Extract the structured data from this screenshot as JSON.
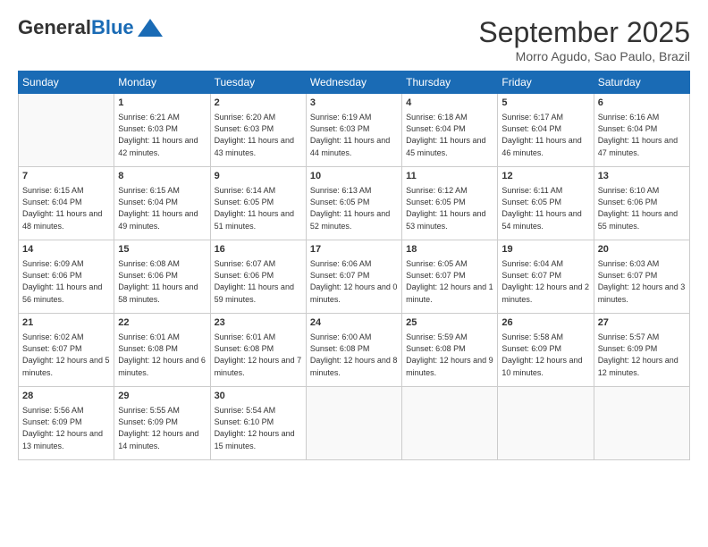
{
  "header": {
    "logo_general": "General",
    "logo_blue": "Blue",
    "month_title": "September 2025",
    "location": "Morro Agudo, Sao Paulo, Brazil"
  },
  "days_of_week": [
    "Sunday",
    "Monday",
    "Tuesday",
    "Wednesday",
    "Thursday",
    "Friday",
    "Saturday"
  ],
  "weeks": [
    [
      {
        "day": "",
        "empty": true
      },
      {
        "day": "1",
        "sunrise": "6:21 AM",
        "sunset": "6:03 PM",
        "daylight": "11 hours and 42 minutes."
      },
      {
        "day": "2",
        "sunrise": "6:20 AM",
        "sunset": "6:03 PM",
        "daylight": "11 hours and 43 minutes."
      },
      {
        "day": "3",
        "sunrise": "6:19 AM",
        "sunset": "6:03 PM",
        "daylight": "11 hours and 44 minutes."
      },
      {
        "day": "4",
        "sunrise": "6:18 AM",
        "sunset": "6:04 PM",
        "daylight": "11 hours and 45 minutes."
      },
      {
        "day": "5",
        "sunrise": "6:17 AM",
        "sunset": "6:04 PM",
        "daylight": "11 hours and 46 minutes."
      },
      {
        "day": "6",
        "sunrise": "6:16 AM",
        "sunset": "6:04 PM",
        "daylight": "11 hours and 47 minutes."
      }
    ],
    [
      {
        "day": "7",
        "sunrise": "6:15 AM",
        "sunset": "6:04 PM",
        "daylight": "11 hours and 48 minutes."
      },
      {
        "day": "8",
        "sunrise": "6:15 AM",
        "sunset": "6:04 PM",
        "daylight": "11 hours and 49 minutes."
      },
      {
        "day": "9",
        "sunrise": "6:14 AM",
        "sunset": "6:05 PM",
        "daylight": "11 hours and 51 minutes."
      },
      {
        "day": "10",
        "sunrise": "6:13 AM",
        "sunset": "6:05 PM",
        "daylight": "11 hours and 52 minutes."
      },
      {
        "day": "11",
        "sunrise": "6:12 AM",
        "sunset": "6:05 PM",
        "daylight": "11 hours and 53 minutes."
      },
      {
        "day": "12",
        "sunrise": "6:11 AM",
        "sunset": "6:05 PM",
        "daylight": "11 hours and 54 minutes."
      },
      {
        "day": "13",
        "sunrise": "6:10 AM",
        "sunset": "6:06 PM",
        "daylight": "11 hours and 55 minutes."
      }
    ],
    [
      {
        "day": "14",
        "sunrise": "6:09 AM",
        "sunset": "6:06 PM",
        "daylight": "11 hours and 56 minutes."
      },
      {
        "day": "15",
        "sunrise": "6:08 AM",
        "sunset": "6:06 PM",
        "daylight": "11 hours and 58 minutes."
      },
      {
        "day": "16",
        "sunrise": "6:07 AM",
        "sunset": "6:06 PM",
        "daylight": "11 hours and 59 minutes."
      },
      {
        "day": "17",
        "sunrise": "6:06 AM",
        "sunset": "6:07 PM",
        "daylight": "12 hours and 0 minutes."
      },
      {
        "day": "18",
        "sunrise": "6:05 AM",
        "sunset": "6:07 PM",
        "daylight": "12 hours and 1 minute."
      },
      {
        "day": "19",
        "sunrise": "6:04 AM",
        "sunset": "6:07 PM",
        "daylight": "12 hours and 2 minutes."
      },
      {
        "day": "20",
        "sunrise": "6:03 AM",
        "sunset": "6:07 PM",
        "daylight": "12 hours and 3 minutes."
      }
    ],
    [
      {
        "day": "21",
        "sunrise": "6:02 AM",
        "sunset": "6:07 PM",
        "daylight": "12 hours and 5 minutes."
      },
      {
        "day": "22",
        "sunrise": "6:01 AM",
        "sunset": "6:08 PM",
        "daylight": "12 hours and 6 minutes."
      },
      {
        "day": "23",
        "sunrise": "6:01 AM",
        "sunset": "6:08 PM",
        "daylight": "12 hours and 7 minutes."
      },
      {
        "day": "24",
        "sunrise": "6:00 AM",
        "sunset": "6:08 PM",
        "daylight": "12 hours and 8 minutes."
      },
      {
        "day": "25",
        "sunrise": "5:59 AM",
        "sunset": "6:08 PM",
        "daylight": "12 hours and 9 minutes."
      },
      {
        "day": "26",
        "sunrise": "5:58 AM",
        "sunset": "6:09 PM",
        "daylight": "12 hours and 10 minutes."
      },
      {
        "day": "27",
        "sunrise": "5:57 AM",
        "sunset": "6:09 PM",
        "daylight": "12 hours and 12 minutes."
      }
    ],
    [
      {
        "day": "28",
        "sunrise": "5:56 AM",
        "sunset": "6:09 PM",
        "daylight": "12 hours and 13 minutes."
      },
      {
        "day": "29",
        "sunrise": "5:55 AM",
        "sunset": "6:09 PM",
        "daylight": "12 hours and 14 minutes."
      },
      {
        "day": "30",
        "sunrise": "5:54 AM",
        "sunset": "6:10 PM",
        "daylight": "12 hours and 15 minutes."
      },
      {
        "day": "",
        "empty": true
      },
      {
        "day": "",
        "empty": true
      },
      {
        "day": "",
        "empty": true
      },
      {
        "day": "",
        "empty": true
      }
    ]
  ]
}
